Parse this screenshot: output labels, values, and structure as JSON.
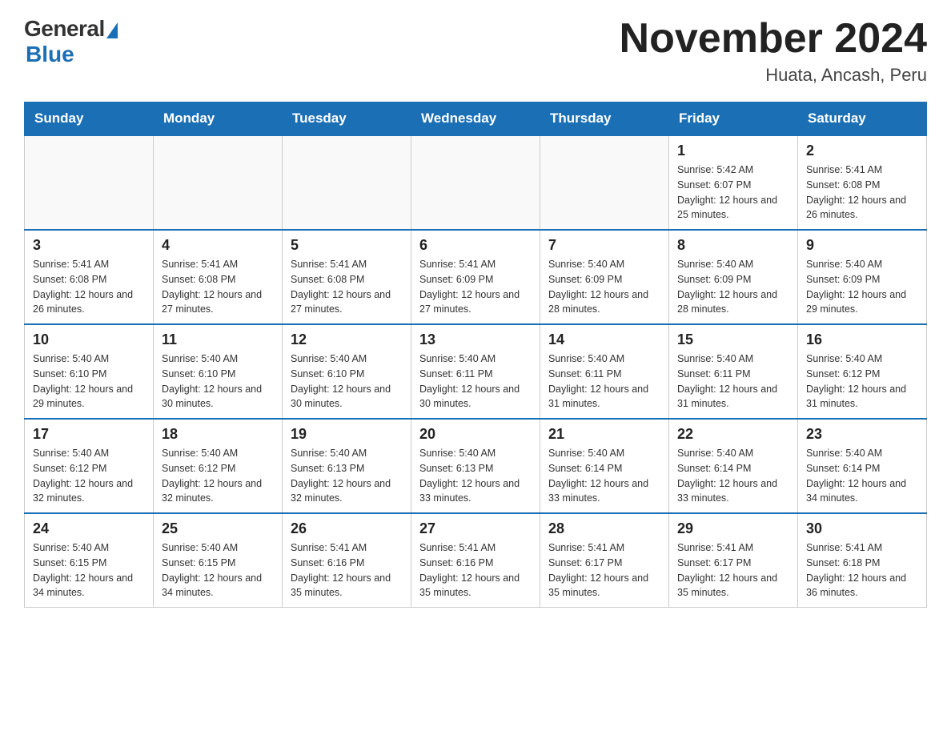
{
  "header": {
    "logo_general": "General",
    "logo_blue": "Blue",
    "month_title": "November 2024",
    "location": "Huata, Ancash, Peru"
  },
  "days_of_week": [
    "Sunday",
    "Monday",
    "Tuesday",
    "Wednesday",
    "Thursday",
    "Friday",
    "Saturday"
  ],
  "weeks": [
    [
      {
        "day": "",
        "info": ""
      },
      {
        "day": "",
        "info": ""
      },
      {
        "day": "",
        "info": ""
      },
      {
        "day": "",
        "info": ""
      },
      {
        "day": "",
        "info": ""
      },
      {
        "day": "1",
        "info": "Sunrise: 5:42 AM\nSunset: 6:07 PM\nDaylight: 12 hours and 25 minutes."
      },
      {
        "day": "2",
        "info": "Sunrise: 5:41 AM\nSunset: 6:08 PM\nDaylight: 12 hours and 26 minutes."
      }
    ],
    [
      {
        "day": "3",
        "info": "Sunrise: 5:41 AM\nSunset: 6:08 PM\nDaylight: 12 hours and 26 minutes."
      },
      {
        "day": "4",
        "info": "Sunrise: 5:41 AM\nSunset: 6:08 PM\nDaylight: 12 hours and 27 minutes."
      },
      {
        "day": "5",
        "info": "Sunrise: 5:41 AM\nSunset: 6:08 PM\nDaylight: 12 hours and 27 minutes."
      },
      {
        "day": "6",
        "info": "Sunrise: 5:41 AM\nSunset: 6:09 PM\nDaylight: 12 hours and 27 minutes."
      },
      {
        "day": "7",
        "info": "Sunrise: 5:40 AM\nSunset: 6:09 PM\nDaylight: 12 hours and 28 minutes."
      },
      {
        "day": "8",
        "info": "Sunrise: 5:40 AM\nSunset: 6:09 PM\nDaylight: 12 hours and 28 minutes."
      },
      {
        "day": "9",
        "info": "Sunrise: 5:40 AM\nSunset: 6:09 PM\nDaylight: 12 hours and 29 minutes."
      }
    ],
    [
      {
        "day": "10",
        "info": "Sunrise: 5:40 AM\nSunset: 6:10 PM\nDaylight: 12 hours and 29 minutes."
      },
      {
        "day": "11",
        "info": "Sunrise: 5:40 AM\nSunset: 6:10 PM\nDaylight: 12 hours and 30 minutes."
      },
      {
        "day": "12",
        "info": "Sunrise: 5:40 AM\nSunset: 6:10 PM\nDaylight: 12 hours and 30 minutes."
      },
      {
        "day": "13",
        "info": "Sunrise: 5:40 AM\nSunset: 6:11 PM\nDaylight: 12 hours and 30 minutes."
      },
      {
        "day": "14",
        "info": "Sunrise: 5:40 AM\nSunset: 6:11 PM\nDaylight: 12 hours and 31 minutes."
      },
      {
        "day": "15",
        "info": "Sunrise: 5:40 AM\nSunset: 6:11 PM\nDaylight: 12 hours and 31 minutes."
      },
      {
        "day": "16",
        "info": "Sunrise: 5:40 AM\nSunset: 6:12 PM\nDaylight: 12 hours and 31 minutes."
      }
    ],
    [
      {
        "day": "17",
        "info": "Sunrise: 5:40 AM\nSunset: 6:12 PM\nDaylight: 12 hours and 32 minutes."
      },
      {
        "day": "18",
        "info": "Sunrise: 5:40 AM\nSunset: 6:12 PM\nDaylight: 12 hours and 32 minutes."
      },
      {
        "day": "19",
        "info": "Sunrise: 5:40 AM\nSunset: 6:13 PM\nDaylight: 12 hours and 32 minutes."
      },
      {
        "day": "20",
        "info": "Sunrise: 5:40 AM\nSunset: 6:13 PM\nDaylight: 12 hours and 33 minutes."
      },
      {
        "day": "21",
        "info": "Sunrise: 5:40 AM\nSunset: 6:14 PM\nDaylight: 12 hours and 33 minutes."
      },
      {
        "day": "22",
        "info": "Sunrise: 5:40 AM\nSunset: 6:14 PM\nDaylight: 12 hours and 33 minutes."
      },
      {
        "day": "23",
        "info": "Sunrise: 5:40 AM\nSunset: 6:14 PM\nDaylight: 12 hours and 34 minutes."
      }
    ],
    [
      {
        "day": "24",
        "info": "Sunrise: 5:40 AM\nSunset: 6:15 PM\nDaylight: 12 hours and 34 minutes."
      },
      {
        "day": "25",
        "info": "Sunrise: 5:40 AM\nSunset: 6:15 PM\nDaylight: 12 hours and 34 minutes."
      },
      {
        "day": "26",
        "info": "Sunrise: 5:41 AM\nSunset: 6:16 PM\nDaylight: 12 hours and 35 minutes."
      },
      {
        "day": "27",
        "info": "Sunrise: 5:41 AM\nSunset: 6:16 PM\nDaylight: 12 hours and 35 minutes."
      },
      {
        "day": "28",
        "info": "Sunrise: 5:41 AM\nSunset: 6:17 PM\nDaylight: 12 hours and 35 minutes."
      },
      {
        "day": "29",
        "info": "Sunrise: 5:41 AM\nSunset: 6:17 PM\nDaylight: 12 hours and 35 minutes."
      },
      {
        "day": "30",
        "info": "Sunrise: 5:41 AM\nSunset: 6:18 PM\nDaylight: 12 hours and 36 minutes."
      }
    ]
  ]
}
